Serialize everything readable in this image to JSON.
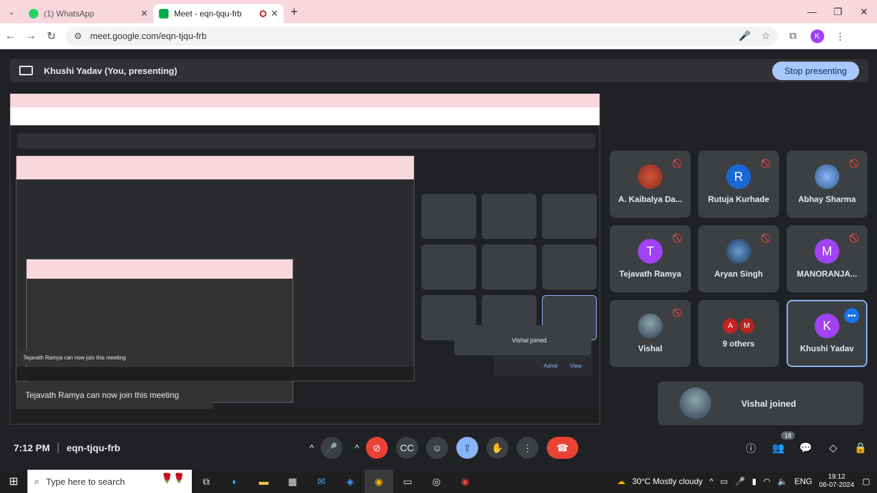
{
  "browser": {
    "tabs": [
      {
        "title": "(1) WhatsApp",
        "icon": "whatsapp-icon",
        "active": false
      },
      {
        "title": "Meet - eqn-tjqu-frb",
        "icon": "meet-icon",
        "active": true
      }
    ],
    "url": "meet.google.com/eqn-tjqu-frb",
    "profile": "K"
  },
  "presenting_bar": {
    "title": "Khushi Yadav (You, presenting)",
    "stop_label": "Stop presenting"
  },
  "screen_share": {
    "toast": "Tejavath Ramya can now join this meeting",
    "nested_toast": "Tejavath Ramya can now join this meeting",
    "nested_joined": "Vishal joined",
    "nested_admit": "Admit",
    "nested_view": "View"
  },
  "participants": [
    {
      "name": "A. Kaibalya Da...",
      "initial": "",
      "color": "#5f6368",
      "photo": true,
      "muted": true
    },
    {
      "name": "Rutuja Kurhade",
      "initial": "R",
      "color": "#1967d2",
      "photo": false,
      "muted": true
    },
    {
      "name": "Abhay Sharma",
      "initial": "",
      "color": "#5f6368",
      "photo": true,
      "muted": true
    },
    {
      "name": "Tejavath Ramya",
      "initial": "T",
      "color": "#a142f4",
      "photo": false,
      "muted": true
    },
    {
      "name": "Aryan Singh",
      "initial": "",
      "color": "#5f6368",
      "photo": true,
      "muted": true
    },
    {
      "name": "MANORANJA...",
      "initial": "M",
      "color": "#a142f4",
      "photo": false,
      "muted": true
    },
    {
      "name": "Vishal",
      "initial": "",
      "color": "#5f6368",
      "photo": true,
      "muted": true
    },
    {
      "name": "9 others",
      "initial": "A",
      "initial2": "M",
      "color": "#c5221f",
      "color2": "#b3261e",
      "photo": false,
      "muted": false
    },
    {
      "name": "Khushi Yadav",
      "initial": "K",
      "color": "#a142f4",
      "photo": false,
      "muted": false,
      "selected": true
    }
  ],
  "join_notice": {
    "text": "Vishal joined"
  },
  "meeting": {
    "time": "7:12 PM",
    "code": "eqn-tjqu-frb",
    "people_count": "18"
  },
  "taskbar": {
    "search_placeholder": "Type here to search",
    "weather": "30°C  Mostly cloudy",
    "lang": "ENG",
    "clock_time": "19:12",
    "clock_date": "06-07-2024"
  }
}
